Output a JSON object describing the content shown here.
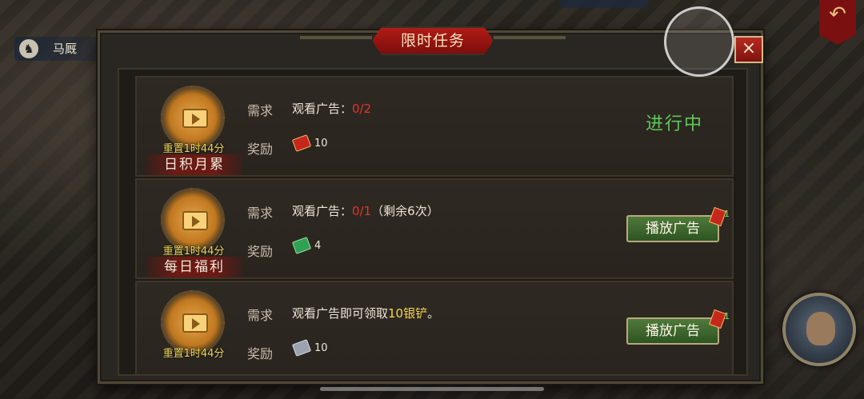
{
  "background": {
    "top_left_tag": "马厩",
    "horse_icon": "horse-icon",
    "return_icon": "return-arrow-icon"
  },
  "dialog": {
    "title": "限时任务",
    "close_label": "×",
    "req_label": "需求",
    "reward_label": "奖励",
    "tasks": [
      {
        "name": "日积月累",
        "reset": "重置1时44分",
        "req_prefix": "观看广告：",
        "req_progress": "0/2",
        "req_suffix": "",
        "reward_icon": "red-envelope-icon",
        "reward_value": "10",
        "status": "进行中"
      },
      {
        "name": "每日福利",
        "reset": "重置1时44分",
        "req_prefix": "观看广告：",
        "req_progress": "0/1",
        "req_suffix": "（剩余6次）",
        "reward_icon": "green-ticket-icon",
        "reward_value": "4",
        "button": "播放广告",
        "button_badge": "1"
      },
      {
        "name": "",
        "reset": "重置1时44分",
        "req_prefix": "观看广告即可领取",
        "req_highlight": "10银铲",
        "req_suffix": "。",
        "reward_icon": "silver-shovel-icon",
        "reward_value": "10",
        "button": "播放广告",
        "button_badge": "1"
      }
    ]
  },
  "colors": {
    "progress_red": "#e2352a",
    "highlight_yellow": "#f3d74a",
    "status_green": "#5ec95a",
    "title_red": "#b01b16"
  }
}
